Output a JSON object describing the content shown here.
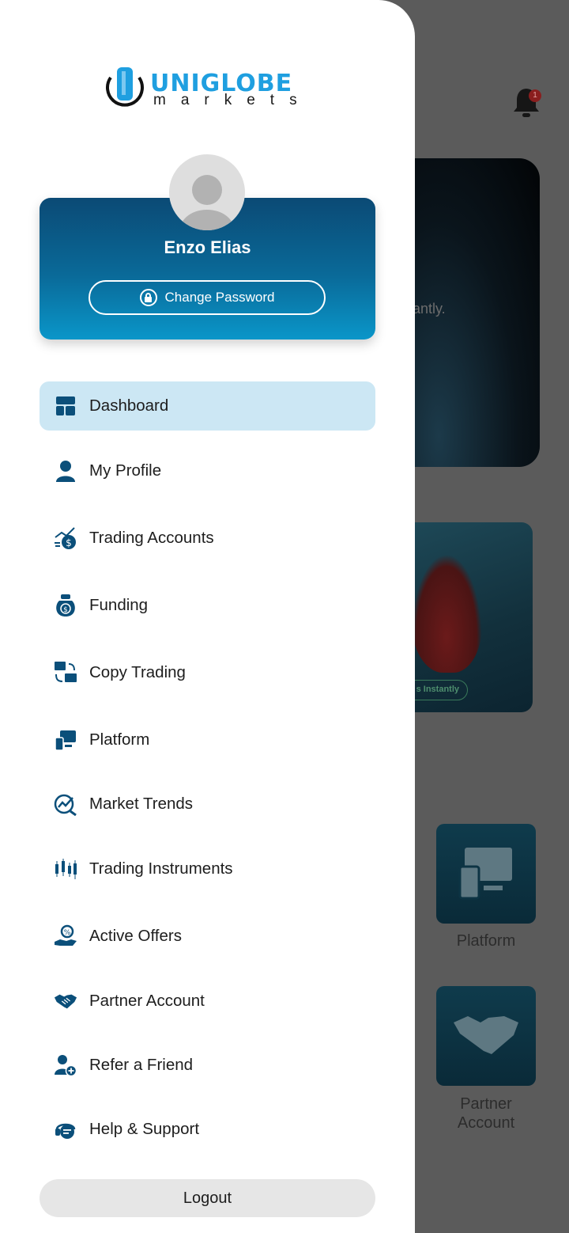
{
  "background": {
    "hero_text": "antly.",
    "promo_pill": "s Instantly",
    "tiles": [
      {
        "label": "Platform"
      },
      {
        "label": "Partner Account"
      }
    ],
    "notification_count": "1"
  },
  "drawer": {
    "logo": {
      "word": "UNIGLOBE",
      "sub": "markets"
    },
    "user": {
      "name": "Enzo Elias",
      "change_password_label": "Change Password"
    },
    "menu": [
      {
        "label": "Dashboard",
        "icon": "dashboard-icon",
        "active": true
      },
      {
        "label": "My Profile",
        "icon": "user-icon"
      },
      {
        "label": "Trading Accounts",
        "icon": "trading-accounts-icon"
      },
      {
        "label": "Funding",
        "icon": "money-bag-icon"
      },
      {
        "label": "Copy Trading",
        "icon": "copy-trading-icon"
      },
      {
        "label": "Platform",
        "icon": "platform-icon"
      },
      {
        "label": "Market Trends",
        "icon": "market-trends-icon"
      },
      {
        "label": "Trading Instruments",
        "icon": "candlestick-icon"
      },
      {
        "label": "Active Offers",
        "icon": "offers-icon"
      },
      {
        "label": "Partner Account",
        "icon": "handshake-icon"
      },
      {
        "label": "Refer a Friend",
        "icon": "refer-friend-icon"
      },
      {
        "label": "Help & Support",
        "icon": "support-icon"
      }
    ],
    "logout_label": "Logout"
  },
  "colors": {
    "accent_dark": "#0b4a75",
    "accent_light": "#0a96c9",
    "icon": "#0b4f7a",
    "active_bg": "#cce7f4"
  }
}
